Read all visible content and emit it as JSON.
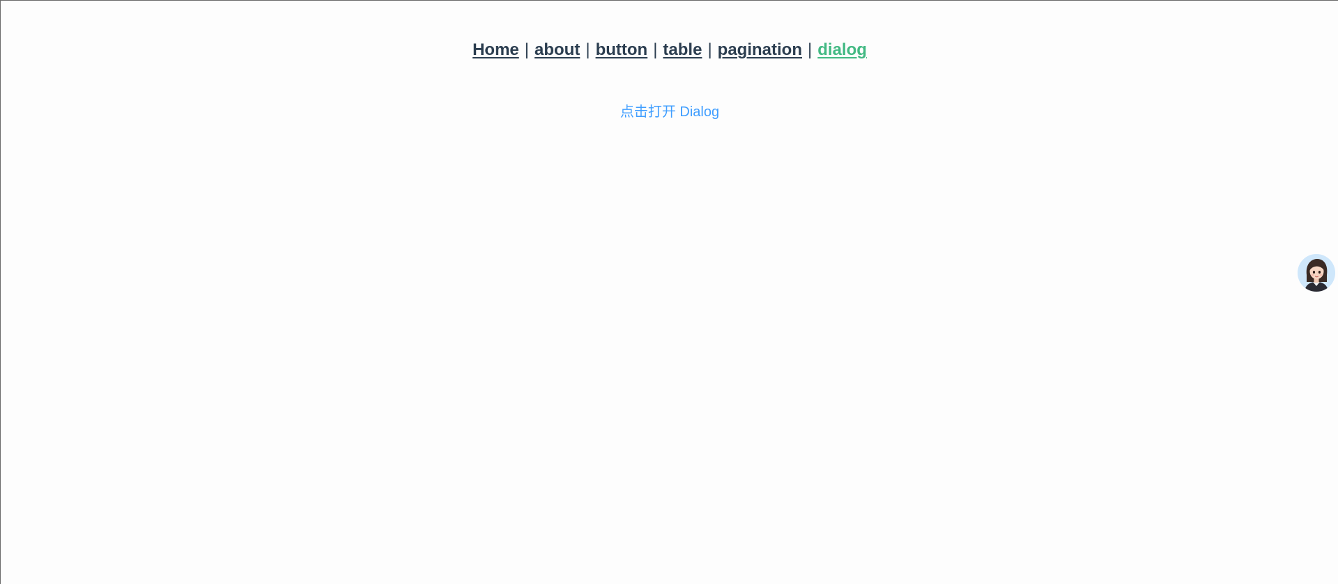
{
  "nav": {
    "items": [
      {
        "label": "Home",
        "active": false
      },
      {
        "label": "about",
        "active": false
      },
      {
        "label": "button",
        "active": false
      },
      {
        "label": "table",
        "active": false
      },
      {
        "label": "pagination",
        "active": false
      },
      {
        "label": "dialog",
        "active": true
      }
    ],
    "separator": "|"
  },
  "main": {
    "open_dialog_label": "点击打开 Dialog"
  },
  "assistant": {
    "icon": "avatar-icon"
  },
  "colors": {
    "nav_text": "#2c3e50",
    "nav_active": "#42b983",
    "link_blue": "#409eff"
  }
}
